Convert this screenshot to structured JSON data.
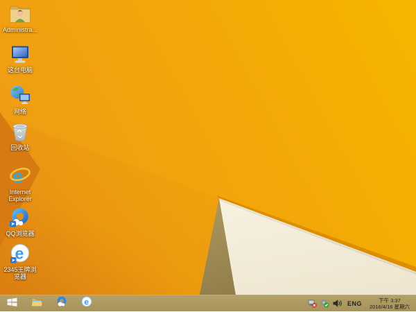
{
  "wallpaper": {
    "base_left": "#EF9B16",
    "base_mid": "#F2A708",
    "base_right": "#F5B400",
    "shade_dark": "#C3610A",
    "dark_wedge": "#D87A12",
    "khaki_top": "#AD9960",
    "khaki_bottom": "#8F7C49",
    "cream_top": "#F7F1E0",
    "cream_bottom": "#EEE6D0",
    "ridge": "#DC8E00"
  },
  "desktop": {
    "icons": [
      {
        "label": "Administra..."
      },
      {
        "label": "这台电脑"
      },
      {
        "label": "网络"
      },
      {
        "label": "回收站"
      },
      {
        "label_line1": "Internet",
        "label_line2": "Explorer"
      },
      {
        "label": "QQ浏览器"
      },
      {
        "label_line1": "2345王牌浏",
        "label_line2": "览器"
      }
    ]
  },
  "taskbar": {
    "background": "#AB9960",
    "buttons": [
      "start",
      "file-explorer",
      "qq-browser",
      "2345-browser"
    ]
  },
  "tray": {
    "icons": [
      "network-disconnected",
      "security-ok",
      "volume"
    ],
    "language": "ENG",
    "time": "下午 3:37",
    "date": "2016/4/16 星期六"
  }
}
